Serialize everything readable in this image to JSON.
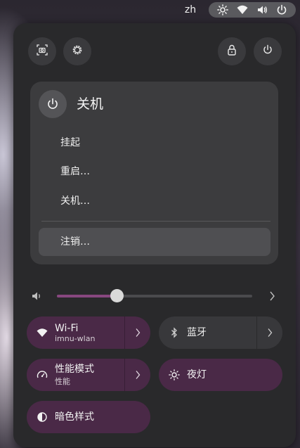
{
  "topbar": {
    "language": "zh",
    "icons": [
      "brightness-icon",
      "wifi-icon",
      "volume-icon",
      "power-icon"
    ]
  },
  "header_buttons": [
    "screenshot-icon",
    "settings-icon",
    "lock-icon",
    "power-icon"
  ],
  "power_menu": {
    "title": "关机",
    "items": [
      {
        "label": "挂起"
      },
      {
        "label": "重启…"
      },
      {
        "label": "关机…"
      },
      {
        "label": "注销…"
      }
    ]
  },
  "volume": {
    "level": 0.31
  },
  "toggles": {
    "wifi": {
      "label": "Wi-Fi",
      "subtitle": "imnu-wlan",
      "on": true
    },
    "bluetooth": {
      "label": "蓝牙",
      "on": false
    },
    "power_mode": {
      "label": "性能模式",
      "subtitle": "性能",
      "on": true
    },
    "night_light": {
      "label": "夜灯",
      "on": true
    },
    "dark_style": {
      "label": "暗色样式",
      "on": true
    }
  },
  "colors": {
    "panel_bg": "#29292b",
    "accent_toggle": "#4a2947",
    "slider_fill": "#87477f"
  }
}
